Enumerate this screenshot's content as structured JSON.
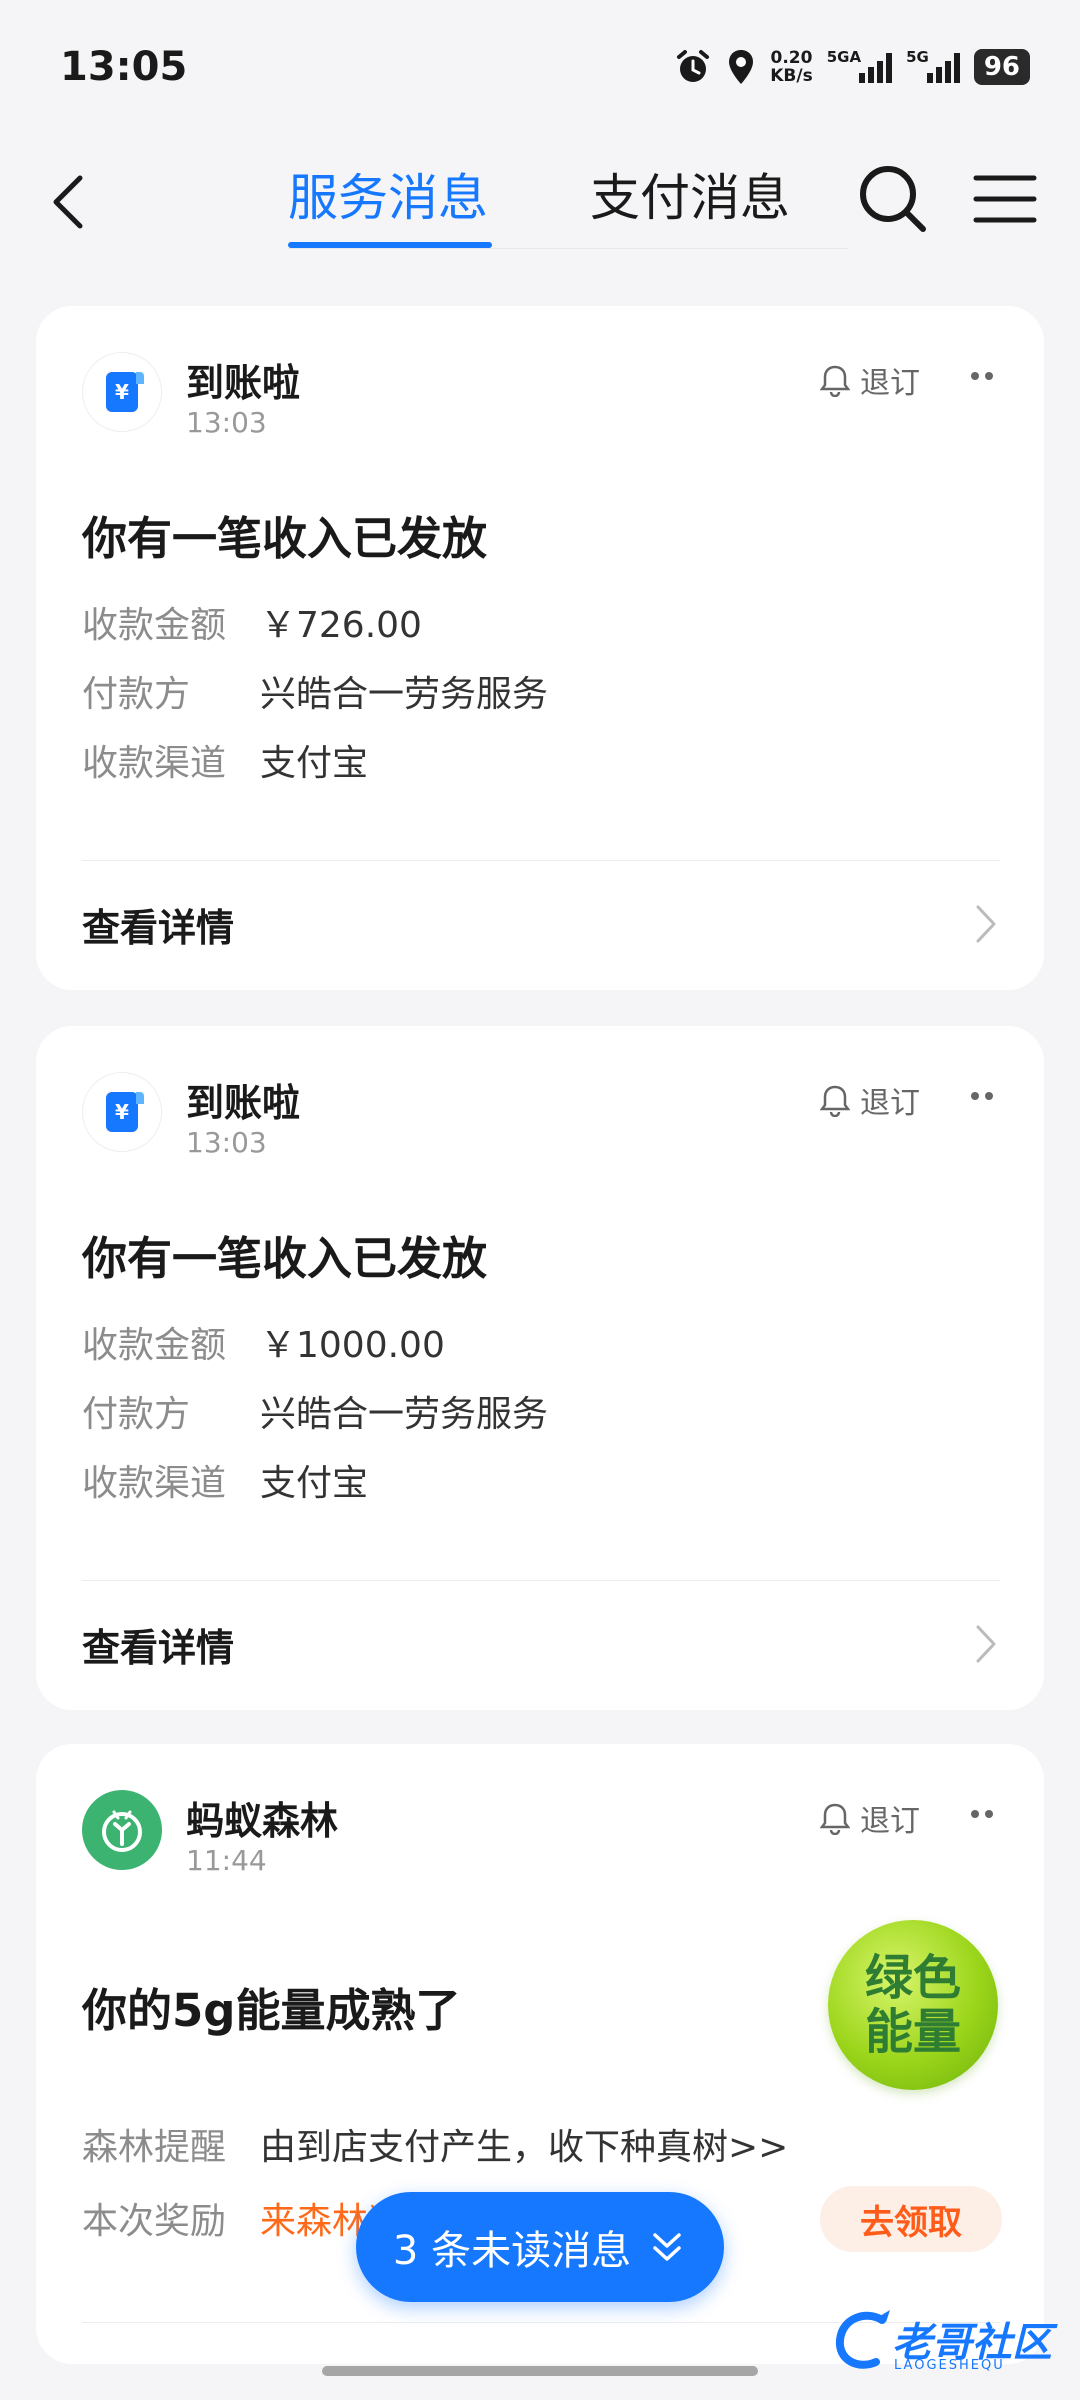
{
  "status_bar": {
    "time": "13:05",
    "net_speed_value": "0.20",
    "net_speed_unit": "KB/s",
    "sim1_label": "5GA",
    "sim2_label": "5G",
    "battery": "96"
  },
  "header": {
    "tabs": [
      {
        "label": "服务消息",
        "active": true
      },
      {
        "label": "支付消息",
        "active": false
      }
    ],
    "accent_color": "#1677ff"
  },
  "cards": [
    {
      "app_name": "到账啦",
      "time": "13:03",
      "unsubscribe_label": "退订",
      "title": "你有一笔收入已发放",
      "rows": [
        {
          "label": "收款金额",
          "value": "￥726.00"
        },
        {
          "label": "付款方",
          "value": "兴皓合一劳务服务"
        },
        {
          "label": "收款渠道",
          "value": "支付宝"
        }
      ],
      "detail_label": "查看详情"
    },
    {
      "app_name": "到账啦",
      "time": "13:03",
      "unsubscribe_label": "退订",
      "title": "你有一笔收入已发放",
      "rows": [
        {
          "label": "收款金额",
          "value": "￥1000.00"
        },
        {
          "label": "付款方",
          "value": "兴皓合一劳务服务"
        },
        {
          "label": "收款渠道",
          "value": "支付宝"
        }
      ],
      "detail_label": "查看详情"
    },
    {
      "app_name": "蚂蚁森林",
      "time": "11:44",
      "unsubscribe_label": "退订",
      "title": "你的5g能量成熟了",
      "badge_line1": "绿色",
      "badge_line2": "能量",
      "rows": [
        {
          "label": "森林提醒",
          "value": "由到店支付产生，收下种真树>>"
        },
        {
          "label": "本次奖励",
          "value": "来森林奖励领取活力值啦"
        }
      ],
      "claim_label": "去领取"
    }
  ],
  "unread_pill": {
    "label": "3 条未读消息"
  },
  "watermark": {
    "text": "老哥社区",
    "sub": "LAOGESHEQU"
  }
}
